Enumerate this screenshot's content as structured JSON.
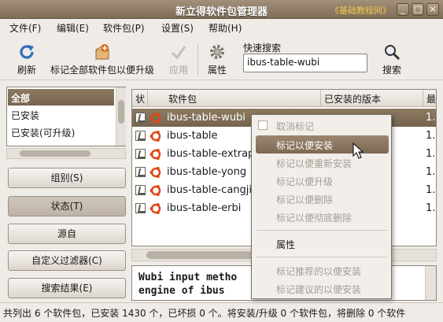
{
  "window": {
    "title": "新立得软件包管理器",
    "watermark": "《基础教程网》",
    "controls": [
      "_",
      "□",
      "×"
    ]
  },
  "menubar": {
    "items": [
      {
        "label": "文件(F)"
      },
      {
        "label": "编辑(E)"
      },
      {
        "label": "软件包(P)"
      },
      {
        "label": "设置(S)"
      },
      {
        "label": "帮助(H)"
      }
    ]
  },
  "toolbar": {
    "refresh_label": "刷新",
    "mark_upgrades_label": "标记全部软件包以便升级",
    "apply_label": "应用",
    "properties_label": "属性",
    "search_label": "搜索",
    "quick_search_label": "快速搜索",
    "quick_search_value": "ibus-table-wubi"
  },
  "filters": {
    "items": [
      {
        "label": "全部",
        "selected": true
      },
      {
        "label": "已安装",
        "selected": false
      },
      {
        "label": "已安装(可升级)",
        "selected": false
      }
    ]
  },
  "left_buttons": {
    "groups": "组别(S)",
    "status": "状态(T)",
    "origin": "源自",
    "custom_filters": "自定义过滤器(C)",
    "search_results": "搜索结果(E)"
  },
  "columns": {
    "status": "状",
    "package": "软件包",
    "installed_version": "已安装的版本",
    "latest": "最"
  },
  "packages": [
    {
      "name": "ibus-table-wubi",
      "version": "1.",
      "selected": true
    },
    {
      "name": "ibus-table",
      "version": "1."
    },
    {
      "name": "ibus-table-extrap",
      "version": "1."
    },
    {
      "name": "ibus-table-yong",
      "version": "1."
    },
    {
      "name": "ibus-table-cangji",
      "version": "1."
    },
    {
      "name": "ibus-table-erbi",
      "version": "1."
    }
  ],
  "description": {
    "line1": "Wubi input metho",
    "line2": "engine of ibus"
  },
  "status_text": "共列出 6 个软件包，已安装 1430 个，已坏损 0 个。将安装/升级 0 个软件包，将删除 0 个软件",
  "context_menu": {
    "unmark": "取消标记",
    "mark_install": "标记以便安装",
    "mark_reinstall": "标记以便重新安装",
    "mark_upgrade": "标记以便升级",
    "mark_remove": "标记以便删除",
    "mark_purge": "标记以便彻底删除",
    "properties": "属性",
    "mark_recommended": "标记推荐的以便安装",
    "mark_suggested": "标记建议的以便安装"
  },
  "colors": {
    "selection": "#7f6c56",
    "titlebar": "#8f7c66",
    "watermark": "#f0c84a"
  }
}
